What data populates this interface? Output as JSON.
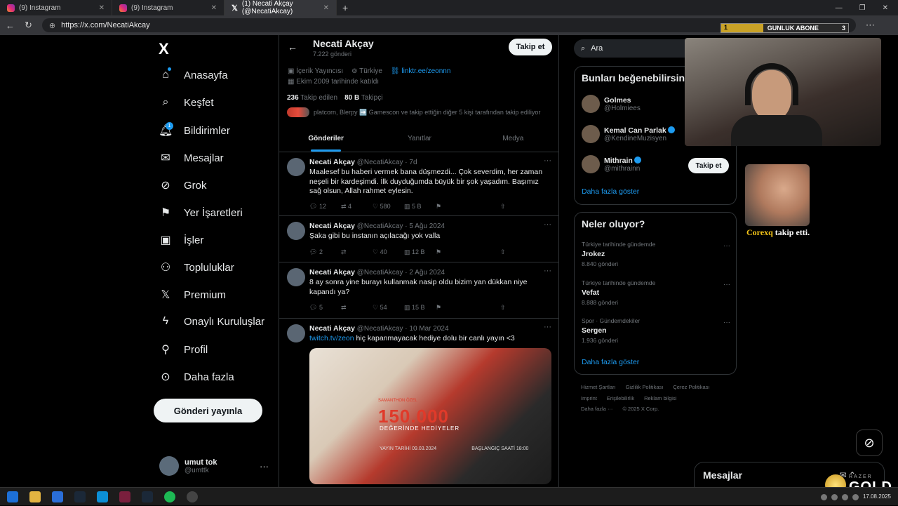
{
  "browser": {
    "tabs": [
      {
        "title": "(9) Instagram"
      },
      {
        "title": "(9) Instagram"
      },
      {
        "title": "(1) Necati Akçay (@NecatiAkcay)"
      }
    ],
    "url": "https://x.com/NecatiAkcay"
  },
  "overlay": {
    "goal_label": "GUNLUK ABONE",
    "goal_current": "1",
    "goal_target": "3",
    "goal_progress": 0.33,
    "alert_user": "Corexq",
    "alert_text": "takip etti.",
    "brand": "GOLD",
    "brand_small": "RAZER"
  },
  "sidebar": {
    "logo": "X",
    "notif_count": "1",
    "items": [
      {
        "label": "Anasayfa"
      },
      {
        "label": "Keşfet"
      },
      {
        "label": "Bildirimler"
      },
      {
        "label": "Mesajlar"
      },
      {
        "label": "Grok"
      },
      {
        "label": "Yer İşaretleri"
      },
      {
        "label": "İşler"
      },
      {
        "label": "Topluluklar"
      },
      {
        "label": "Premium"
      },
      {
        "label": "Onaylı Kuruluşlar"
      },
      {
        "label": "Profil"
      },
      {
        "label": "Daha fazla"
      }
    ],
    "post_button": "Gönderi yayınla",
    "account": {
      "name": "umut tok",
      "handle": "@umttk"
    }
  },
  "profile": {
    "name": "Necati Akçay",
    "post_count": "7.222 gönderi",
    "follow_button": "Takip et",
    "category": "İçerik Yayıncısı",
    "location": "Türkiye",
    "link": "linktr.ee/zeonnn",
    "joined": "Ekim 2009 tarihinde katıldı",
    "following_count": "236",
    "following_label": "Takip edilen",
    "followers_count": "80 B",
    "followers_label": "Takipçi",
    "mutual": "platcorn, Blerpy ➡️ Gamescon ve takip ettiğin diğer 5 kişi tarafından takip ediliyor",
    "tabs": [
      "Gönderiler",
      "Yanıtlar",
      "Medya"
    ]
  },
  "tweets": [
    {
      "name": "Necati Akçay",
      "handle": "@NecatiAkcay",
      "time": "· 7d",
      "text": "Maalesef bu haberi vermek bana düşmezdi... Çok severdim, her zaman neşeli bir kardeşimdi. İlk duyduğumda büyük bir şok yaşadım. Başımız sağ olsun, Allah rahmet eylesin.",
      "replies": "12",
      "retweets": "4",
      "likes": "580",
      "views": "5 B"
    },
    {
      "name": "Necati Akçay",
      "handle": "@NecatiAkcay",
      "time": "· 5 Ağu 2024",
      "text": "Şaka gibi bu instanın açılacağı yok valla",
      "replies": "2",
      "retweets": "",
      "likes": "40",
      "views": "12 B"
    },
    {
      "name": "Necati Akçay",
      "handle": "@NecatiAkcay",
      "time": "· 2 Ağu 2024",
      "text": "8 ay sonra yine burayı kullanmak nasip oldu bizim yan dükkan niye kapandı ya?",
      "replies": "5",
      "retweets": "",
      "likes": "54",
      "views": "15 B"
    },
    {
      "name": "Necati Akçay",
      "handle": "@NecatiAkcay",
      "time": "· 10 Mar 2024",
      "link": "twitch.tv/zeon",
      "text": "hiç kapanmayacak hediye dolu bir canlı yayın <3",
      "media": {
        "top": "SAMANTHON ÖZEL",
        "big": "150.000",
        "sub": "DEĞERİNDE HEDİYELER",
        "d1": "YAYIN TARİHİ 09.03.2024",
        "d2": "BAŞLANGIÇ SAATİ 18:00"
      }
    }
  ],
  "right": {
    "search_placeholder": "Ara",
    "suggest_title": "Bunları beğenebilirsin",
    "suggestions": [
      {
        "name": "Golmes",
        "handle": "@Holmiees",
        "verified": false
      },
      {
        "name": "Kemal Can Parlak",
        "handle": "@KendineMuzisyen",
        "verified": true
      },
      {
        "name": "Mithrain",
        "handle": "@mithrainn",
        "verified": true
      }
    ],
    "suggest_follow": "Takip et",
    "show_more": "Daha fazla göster",
    "trends_title": "Neler oluyor?",
    "trends": [
      {
        "context": "Türkiye tarihinde gündemde",
        "topic": "Jrokez",
        "posts": "8.840 gönderi"
      },
      {
        "context": "Türkiye tarihinde gündemde",
        "topic": "Vefat",
        "posts": "8.888 gönderi"
      },
      {
        "context": "Spor · Gündemdekiler",
        "topic": "Sergen",
        "posts": "1.936 gönderi"
      }
    ],
    "trends_more": "Daha fazla göster",
    "footer1": [
      "Hizmet Şartları",
      "Gizlilik Politikası",
      "Çerez Politikası"
    ],
    "footer2": [
      "Imprint",
      "Erişilebilirlik",
      "Reklam bilgisi"
    ],
    "footer3": [
      "Daha fazla ···",
      "© 2025 X Corp."
    ]
  },
  "messages_bar": "Mesajlar",
  "taskbar": {
    "date": "17.08.2025"
  }
}
